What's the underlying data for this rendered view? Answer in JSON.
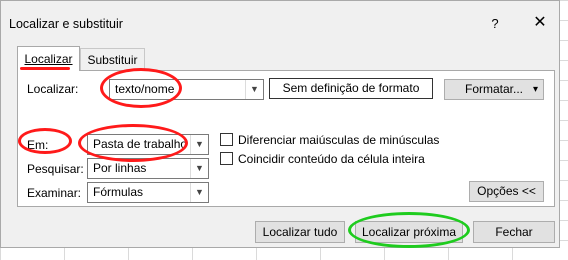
{
  "window": {
    "title": "Localizar e substituir",
    "help": "?",
    "close": "✕"
  },
  "tabs": {
    "find": "Localizar",
    "replace": "Substituir"
  },
  "find": {
    "label": "Localizar:",
    "value": "texto/nome",
    "format_preview": "Sem definição de formato",
    "format_button": "Formatar...",
    "format_arrow": "▾"
  },
  "options": {
    "within_label": "Em:",
    "within_value": "Pasta de trabalho",
    "search_label": "Pesquisar:",
    "search_value": "Por linhas",
    "look_in_label": "Examinar:",
    "look_in_value": "Fórmulas",
    "match_case": "Diferenciar maiúsculas de minúsculas",
    "match_entire": "Coincidir conteúdo da célula inteira",
    "options_button": "Opções <<"
  },
  "buttons": {
    "find_all": "Localizar tudo",
    "find_next": "Localizar próxima",
    "close": "Fechar"
  },
  "annotation_colors": {
    "red": "#ff1a1a",
    "green": "#1ecc1e"
  }
}
